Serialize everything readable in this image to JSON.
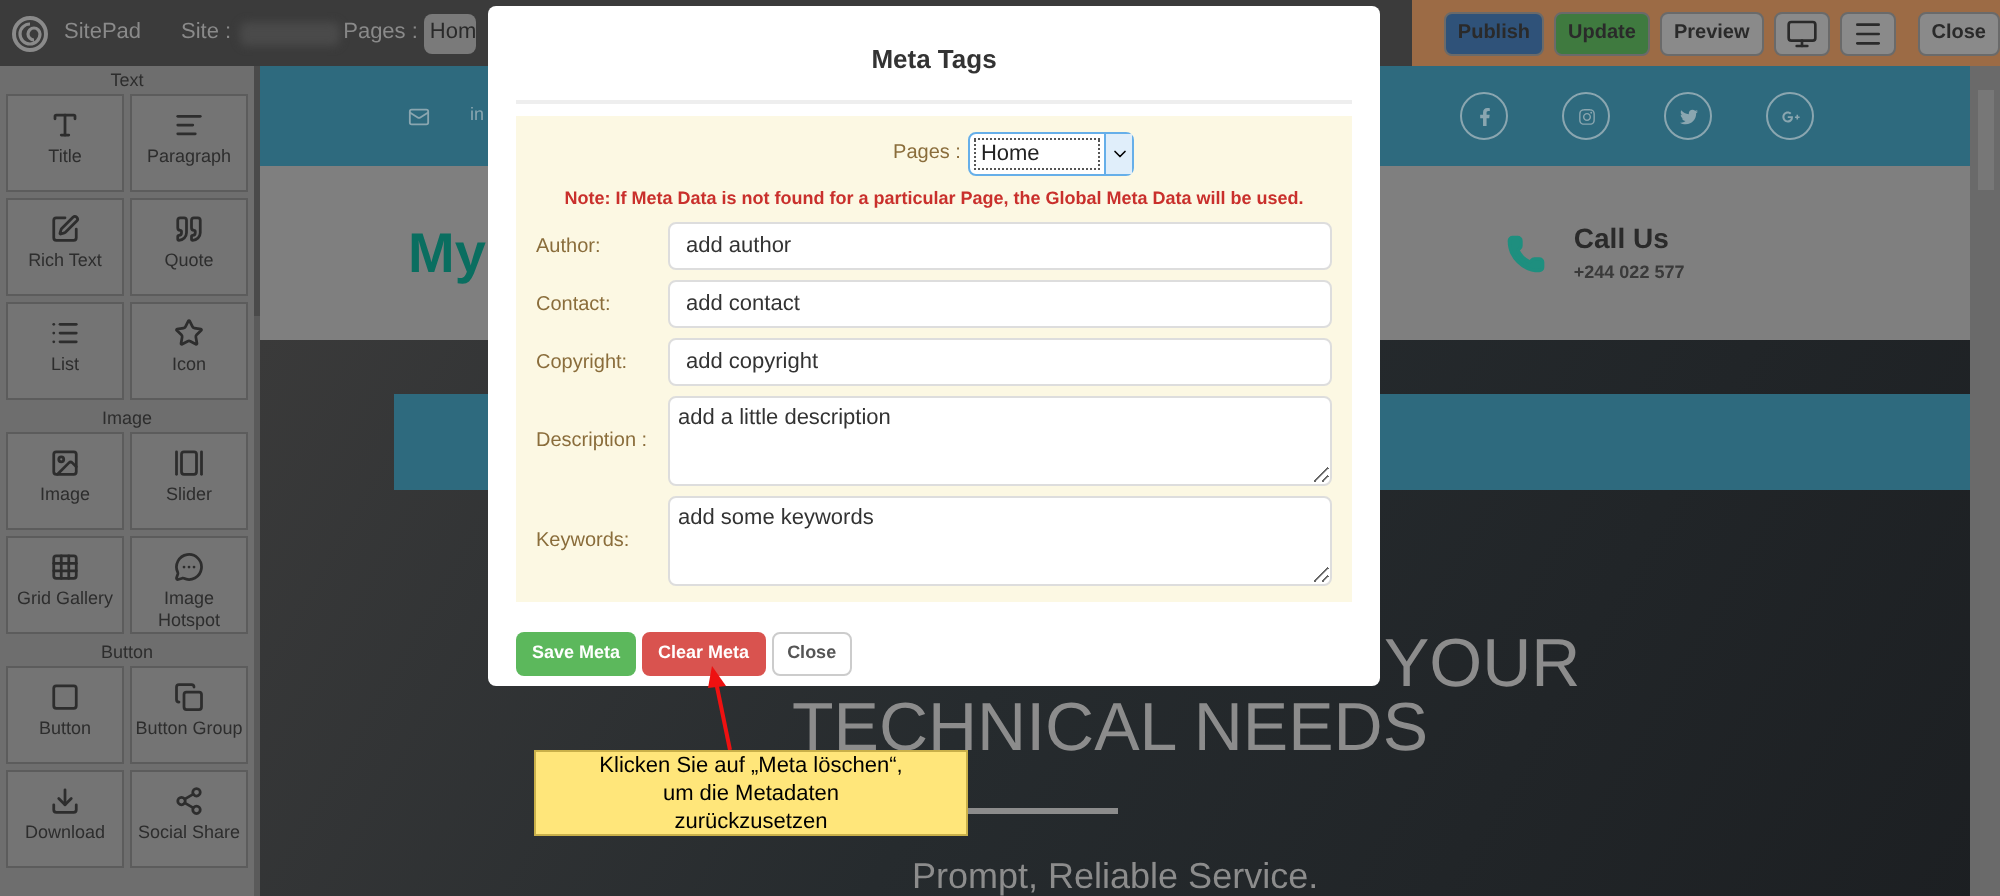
{
  "topbar": {
    "app_name": "SitePad",
    "site_label": "Site :",
    "pages_label": "Pages :",
    "pages_value": "Hom",
    "buttons": [
      {
        "kind": "text",
        "label": "Publish",
        "color": "#2f5279"
      },
      {
        "kind": "text",
        "label": "Update",
        "color": "#3f7a3f"
      },
      {
        "kind": "text",
        "label": "Preview",
        "color": "#8a8a8a"
      },
      {
        "kind": "monitor",
        "color": "#8a8a8a"
      },
      {
        "kind": "menu",
        "color": "#8a8a8a"
      },
      {
        "kind": "text",
        "label": "Close",
        "color": "#8a8a8a"
      }
    ]
  },
  "sidebar": {
    "sections": [
      {
        "title": "Text",
        "items": [
          {
            "kind": "title",
            "label": "Title"
          },
          {
            "kind": "paragraph",
            "label": "Paragraph"
          },
          {
            "kind": "richtext",
            "label": "Rich Text"
          },
          {
            "kind": "quote",
            "label": "Quote"
          },
          {
            "kind": "list",
            "label": "List"
          },
          {
            "kind": "star",
            "label": "Icon"
          }
        ]
      },
      {
        "title": "Image",
        "items": [
          {
            "kind": "image",
            "label": "Image"
          },
          {
            "kind": "slider",
            "label": "Slider"
          },
          {
            "kind": "grid",
            "label": "Grid Gallery"
          },
          {
            "kind": "hotspot",
            "label": "Image Hotspot"
          }
        ]
      },
      {
        "title": "Button",
        "items": [
          {
            "kind": "button",
            "label": "Button"
          },
          {
            "kind": "group",
            "label": "Button Group"
          },
          {
            "kind": "download",
            "label": "Download"
          },
          {
            "kind": "share",
            "label": "Social Share"
          }
        ]
      }
    ]
  },
  "canvas": {
    "email_text": "in",
    "logo_text": "My",
    "call_title": "Call Us",
    "call_phone": "+244 022 577",
    "hero_line_1": "YOUR",
    "hero_line_2": "TECHNICAL NEEDS",
    "hero_subtitle": "Prompt, Reliable Service."
  },
  "modal": {
    "title": "Meta Tags",
    "pages_label": "Pages :",
    "pages_value": "Home",
    "note": "Note: If Meta Data is not found for a particular Page, the Global Meta Data will be used.",
    "fields": [
      {
        "kind": "input",
        "label": "Author:",
        "placeholder": "add author"
      },
      {
        "kind": "input",
        "label": "Contact:",
        "placeholder": "add contact"
      },
      {
        "kind": "input",
        "label": "Copyright:",
        "placeholder": "add copyright"
      },
      {
        "kind": "textarea",
        "label": "Description :",
        "placeholder": "add a little description"
      },
      {
        "kind": "textarea",
        "label": "Keywords:",
        "placeholder": "add some keywords"
      }
    ],
    "buttons": [
      {
        "label": "Save Meta",
        "color": "#5cb85c"
      },
      {
        "label": "Clear Meta",
        "color": "#d9534f"
      },
      {
        "label": "Close",
        "color": "#ffffff"
      }
    ]
  },
  "callout": {
    "text": "Klicken Sie auf „Meta löschen“, um die Metadaten zurückzusetzen"
  }
}
